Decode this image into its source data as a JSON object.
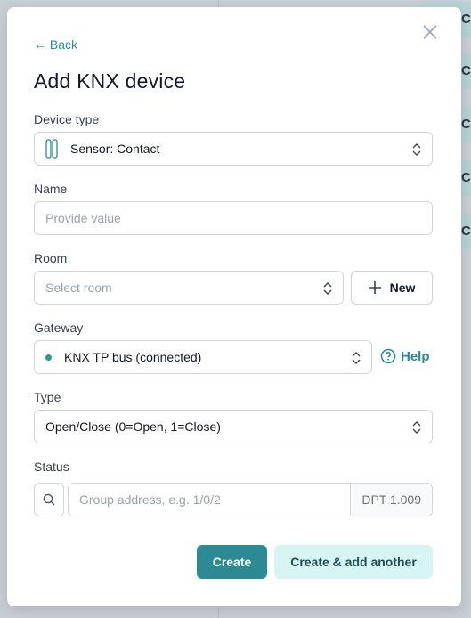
{
  "background": {
    "tiles": [
      "C",
      "C",
      "C",
      "C",
      "C"
    ]
  },
  "modal": {
    "back_label": "Back",
    "title": "Add KNX device",
    "device_type": {
      "label": "Device type",
      "value": "Sensor: Contact",
      "icon": "contact-sensor-icon"
    },
    "name": {
      "label": "Name",
      "placeholder": "Provide value"
    },
    "room": {
      "label": "Room",
      "placeholder": "Select room",
      "new_label": "New"
    },
    "gateway": {
      "label": "Gateway",
      "value": "KNX TP bus (connected)",
      "status_color": "#2b9a9a",
      "help_label": "Help"
    },
    "type": {
      "label": "Type",
      "value": "Open/Close (0=Open, 1=Close)"
    },
    "status": {
      "label": "Status",
      "placeholder": "Group address, e.g. 1/0/2",
      "dpt": "DPT 1.009"
    },
    "create_label": "Create",
    "create_another_label": "Create & add another"
  },
  "colors": {
    "accent": "#2b8a93",
    "secondary_bg": "#d7f4f4"
  }
}
